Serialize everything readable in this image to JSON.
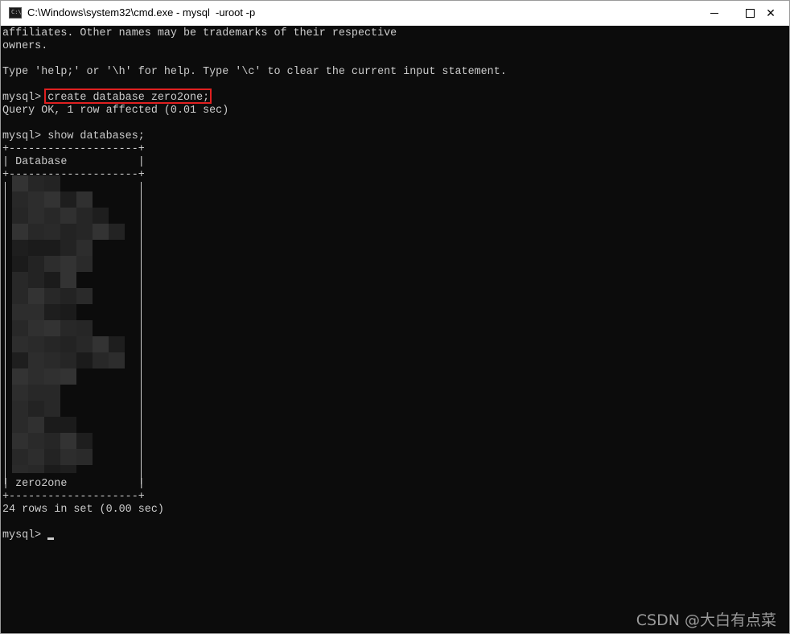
{
  "window": {
    "title": "C:\\Windows\\system32\\cmd.exe - mysql  -uroot -p",
    "icon_label": "C:\\",
    "icon": "cmd-icon",
    "controls": {
      "minimize_icon": "minimize-icon",
      "maximize_icon": "maximize-icon",
      "close_label": "✕"
    }
  },
  "console": {
    "lines": [
      "affiliates. Other names may be trademarks of their respective",
      "owners.",
      "",
      "Type 'help;' or '\\h' for help. Type '\\c' to clear the current input statement.",
      "",
      "mysql> create database zero2one;",
      "Query OK, 1 row affected (0.01 sec)",
      "",
      "mysql> show databases;",
      "+--------------------+",
      "| Database           |",
      "+--------------------+",
      "| zero2one           |",
      "+--------------------+",
      "24 rows in set (0.00 sec)",
      "",
      "mysql> "
    ],
    "highlighted_command": "create database zero2one;",
    "text_color": "#cccccc",
    "background_color": "#0c0c0c",
    "highlight_color": "#e02020"
  },
  "watermark": "CSDN @大白有点菜"
}
